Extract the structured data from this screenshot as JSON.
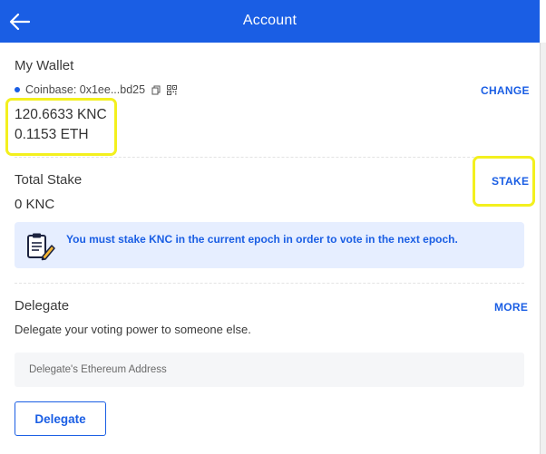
{
  "header": {
    "title": "Account",
    "back_icon": "arrow-left-icon"
  },
  "wallet": {
    "title": "My Wallet",
    "provider": "Coinbase: 0x1ee...bd25",
    "change_label": "CHANGE",
    "balances": [
      "120.6633 KNC",
      "0.1153 ETH"
    ],
    "icons": [
      "copy-icon",
      "qr-code-icon"
    ]
  },
  "stake": {
    "title": "Total Stake",
    "amount": "0 KNC",
    "stake_label": "STAKE",
    "notice": "You must stake KNC in the current epoch in order to vote in the next epoch.",
    "notice_icon": "clipboard-pencil-icon"
  },
  "delegate": {
    "title": "Delegate",
    "more_label": "MORE",
    "description": "Delegate your voting power to someone else.",
    "input_placeholder": "Delegate's Ethereum Address",
    "button_label": "Delegate"
  },
  "colors": {
    "primary": "#1a5ee4",
    "notice_bg": "#e6eeff",
    "highlight": "#f3f01e"
  }
}
